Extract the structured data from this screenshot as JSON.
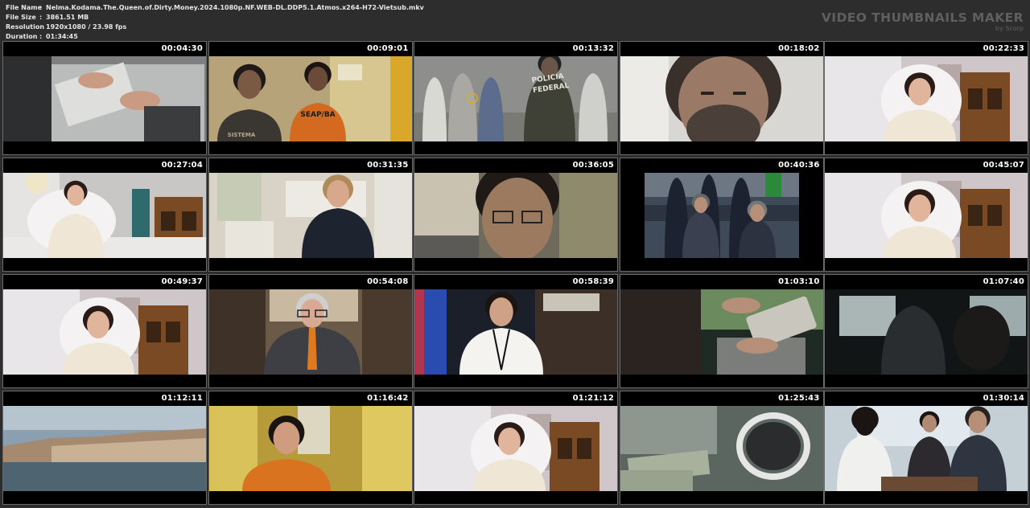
{
  "file_info": {
    "rows": [
      {
        "key": "File Name",
        "value": "Nelma.Kodama.The.Queen.of.Dirty.Money.2024.1080p.NF.WEB-DL.DDP5.1.Atmos.x264-H72-Vietsub.mkv"
      },
      {
        "key": "File Size",
        "value": "3861.51 MB"
      },
      {
        "key": "Resolution",
        "value": "1920x1080 / 23.98 fps"
      },
      {
        "key": "Duration",
        "value": "01:34:45"
      }
    ],
    "separator": ":"
  },
  "brand": {
    "title": "VIDEO THUMBNAILS MAKER",
    "subtitle": "by Scorp"
  },
  "thumbnails": [
    {
      "time": "00:04:30",
      "scene": "hands-desk"
    },
    {
      "time": "00:09:01",
      "scene": "prison-corridor",
      "label": "SEAP/BA",
      "label2": "SISTEMA"
    },
    {
      "time": "00:13:32",
      "scene": "federal-police",
      "label": "POLICIA",
      "label2": "FEDERAL"
    },
    {
      "time": "00:18:02",
      "scene": "man-closeup"
    },
    {
      "time": "00:22:33",
      "scene": "woman-white-chair"
    },
    {
      "time": "00:27:04",
      "scene": "woman-room-wide"
    },
    {
      "time": "00:31:35",
      "scene": "blonde-woman"
    },
    {
      "time": "00:36:05",
      "scene": "man-glasses"
    },
    {
      "time": "00:40:36",
      "scene": "hearing"
    },
    {
      "time": "00:45:07",
      "scene": "woman-white-chair"
    },
    {
      "time": "00:49:37",
      "scene": "woman-white-chair"
    },
    {
      "time": "00:54:08",
      "scene": "man-orange-tie"
    },
    {
      "time": "00:58:39",
      "scene": "woman-tv-studio"
    },
    {
      "time": "01:03:10",
      "scene": "hands-tablet"
    },
    {
      "time": "01:07:40",
      "scene": "car-interior"
    },
    {
      "time": "01:12:11",
      "scene": "city-river"
    },
    {
      "time": "01:16:42",
      "scene": "woman-orange"
    },
    {
      "time": "01:21:12",
      "scene": "woman-white-chair"
    },
    {
      "time": "01:25:43",
      "scene": "money-sunglasses"
    },
    {
      "time": "01:30:14",
      "scene": "meeting"
    }
  ]
}
